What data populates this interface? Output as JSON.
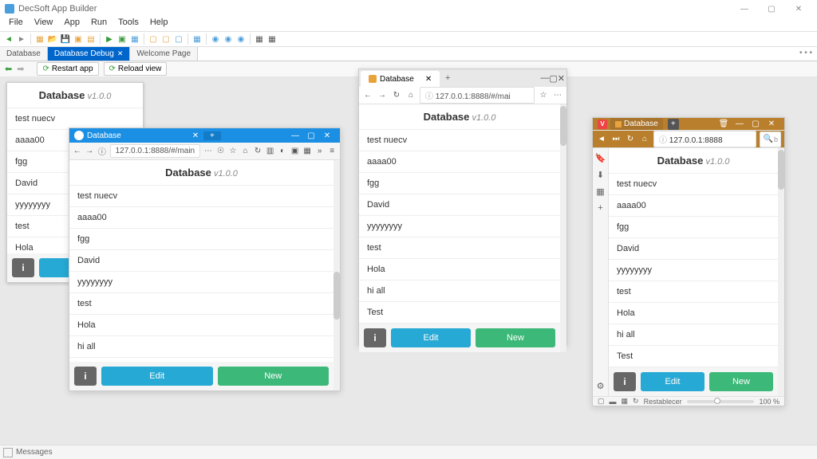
{
  "ide": {
    "title": "DecSoft App Builder",
    "menu": [
      "File",
      "View",
      "App",
      "Run",
      "Tools",
      "Help"
    ],
    "tabs": [
      {
        "label": "Database",
        "active": false
      },
      {
        "label": "Database Debug",
        "active": true,
        "closable": true
      },
      {
        "label": "Welcome Page",
        "active": false
      }
    ],
    "subbar": {
      "restart": "Restart app",
      "reload": "Reload view"
    },
    "status": "Messages"
  },
  "app": {
    "title": "Database",
    "version": "v1.0.0",
    "items_short": [
      "test nuecv",
      "aaaa00",
      "fgg",
      "David",
      "yyyyyyyy",
      "test",
      "Hola"
    ],
    "items_mid": [
      "test nuecv",
      "aaaa00",
      "fgg",
      "David",
      "yyyyyyyy",
      "test",
      "Hola",
      "hi all"
    ],
    "items_full": [
      "test nuecv",
      "aaaa00",
      "fgg",
      "David",
      "yyyyyyyy",
      "test",
      "Hola",
      "hi all",
      "Test"
    ],
    "buttons": {
      "info": "i",
      "edit": "Edit",
      "new": "New"
    }
  },
  "browsers": {
    "firefox": {
      "tab": "Database",
      "url": "127.0.0.1:8888/#/main"
    },
    "edge": {
      "tab": "Database",
      "url": "127.0.0.1:8888/#/mai"
    },
    "vivaldi": {
      "tab": "Database",
      "url": "127.0.0.1:8888",
      "zoom_reset": "Restablecer",
      "zoom": "100 %"
    }
  }
}
